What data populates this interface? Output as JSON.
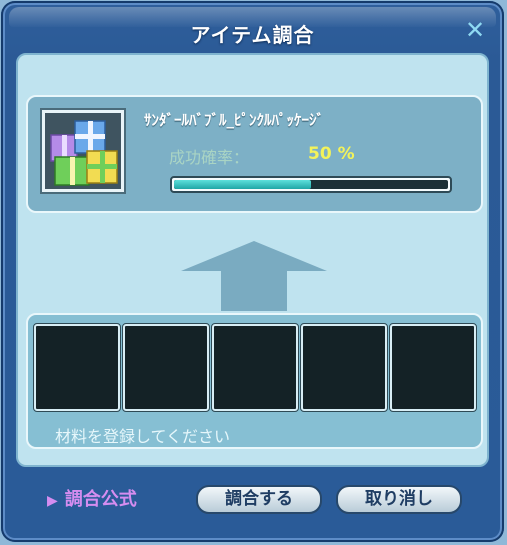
{
  "window": {
    "title": "アイテム調合",
    "close_symbol": "✕"
  },
  "item": {
    "name": "ｻﾝﾀﾞｰﾙﾊﾞﾌﾞﾙ_ﾋﾟﾝｸﾙﾊﾟｯｹｰｼﾞ",
    "icon": "gift-box-icon",
    "success_rate_label": "成功確率：",
    "success_rate_value": "50 %",
    "success_rate": 0.5
  },
  "materials": {
    "slot_count": 5,
    "hint": "材料を登録してください"
  },
  "footer": {
    "recipe_link_icon": "▶",
    "recipe_link_label": "調合公式",
    "combine_button": "調合する",
    "cancel_button": "取り消し"
  },
  "colors": {
    "window_bg": "#2b5a96",
    "panel_bg": "#bfe3ef",
    "progress_fill": "#1fa6a6",
    "rate_value": "#f3f35a",
    "recipe_link": "#d58df0"
  }
}
